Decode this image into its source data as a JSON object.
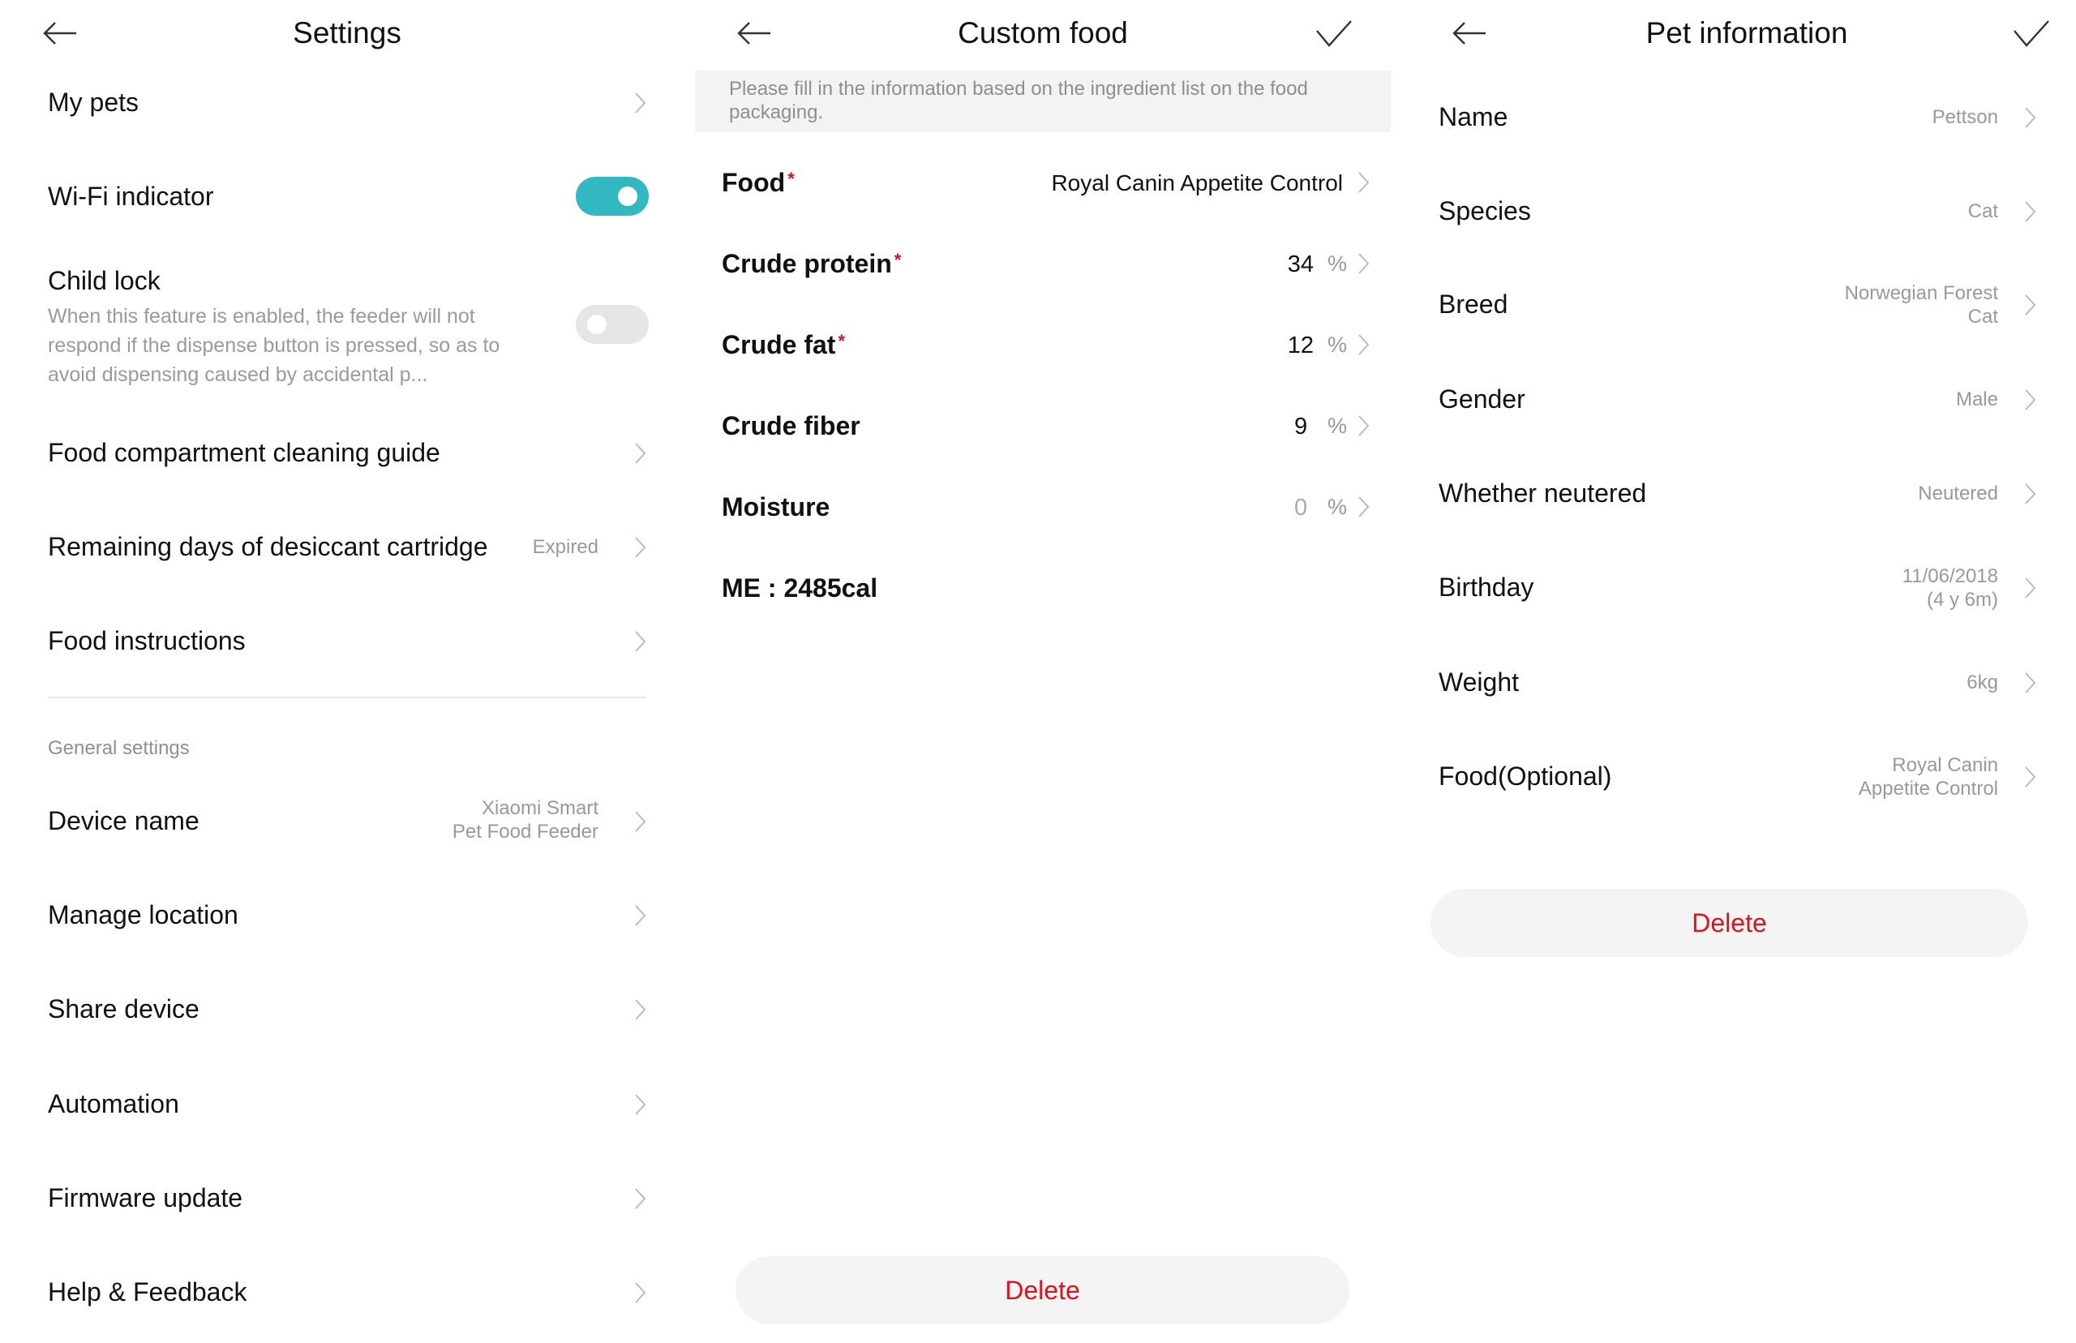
{
  "settings": {
    "title": "Settings",
    "items": {
      "my_pets": "My pets",
      "wifi": "Wi-Fi indicator",
      "child_lock": "Child lock",
      "child_lock_desc": "When this feature is enabled, the feeder will not respond if the dispense button is pressed, so as to avoid dispensing caused by accidental p...",
      "cleaning_guide": "Food compartment cleaning guide",
      "desiccant": "Remaining days of desiccant cartridge",
      "desiccant_value": "Expired",
      "food_instructions": "Food instructions"
    },
    "toggles": {
      "wifi_on": true,
      "child_lock_on": false
    },
    "accent_color": "#32B8C0",
    "general_section": "General settings",
    "general": {
      "device_name": "Device name",
      "device_name_value_1": "Xiaomi Smart",
      "device_name_value_2": "Pet Food Feeder",
      "manage_location": "Manage location",
      "share_device": "Share device",
      "automation": "Automation",
      "firmware": "Firmware update",
      "help": "Help & Feedback"
    }
  },
  "custom_food": {
    "title": "Custom food",
    "banner": "Please fill in the information based on the ingredient list on the food packaging.",
    "required_mark": "*",
    "food_label": "Food",
    "food_value": "Royal Canin Appetite Control",
    "protein_label": "Crude protein",
    "protein_value": "34",
    "fat_label": "Crude fat",
    "fat_value": "12",
    "fiber_label": "Crude fiber",
    "fiber_value": "9",
    "moisture_label": "Moisture",
    "moisture_value": "0",
    "unit": "%",
    "me": "ME : 2485cal",
    "delete": "Delete",
    "danger_color": "#E0121B"
  },
  "pet_info": {
    "title": "Pet information",
    "name_label": "Name",
    "name_value": "Pettson",
    "species_label": "Species",
    "species_value": "Cat",
    "breed_label": "Breed",
    "breed_value_1": "Norwegian Forest",
    "breed_value_2": "Cat",
    "gender_label": "Gender",
    "gender_value": "Male",
    "neutered_label": "Whether neutered",
    "neutered_value": "Neutered",
    "birthday_label": "Birthday",
    "birthday_value_1": "11/06/2018",
    "birthday_value_2": "(4 y 6m)",
    "weight_label": "Weight",
    "weight_value": "6kg",
    "food_label": "Food(Optional)",
    "food_value_1": "Royal Canin",
    "food_value_2": "Appetite Control",
    "delete": "Delete"
  }
}
